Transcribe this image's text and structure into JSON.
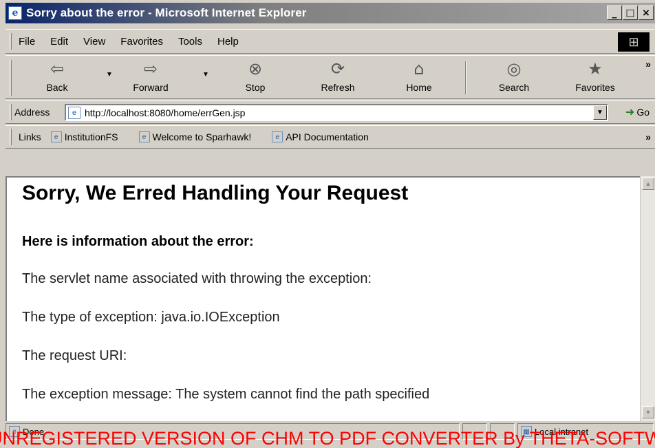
{
  "window": {
    "title": "Sorry about the error - Microsoft Internet Explorer",
    "controls": {
      "minimize": "_",
      "maximize": "□",
      "close": "×"
    }
  },
  "menu": {
    "items": [
      {
        "label": "File"
      },
      {
        "label": "Edit"
      },
      {
        "label": "View"
      },
      {
        "label": "Favorites"
      },
      {
        "label": "Tools"
      },
      {
        "label": "Help"
      }
    ]
  },
  "toolbar": {
    "buttons": [
      {
        "label": "Back",
        "icon": "back-arrow-icon",
        "glyph": "⇦"
      },
      {
        "label": "Forward",
        "icon": "forward-arrow-icon",
        "glyph": "⇨"
      },
      {
        "label": "Stop",
        "icon": "stop-icon",
        "glyph": "⊗"
      },
      {
        "label": "Refresh",
        "icon": "refresh-icon",
        "glyph": "⟳"
      },
      {
        "label": "Home",
        "icon": "home-icon",
        "glyph": "⌂"
      },
      {
        "label": "Search",
        "icon": "search-icon",
        "glyph": "◎"
      },
      {
        "label": "Favorites",
        "icon": "favorites-icon",
        "glyph": "★"
      }
    ],
    "more": "»"
  },
  "address": {
    "label": "Address",
    "url": "http://localhost:8080/home/errGen.jsp",
    "go_label": "Go"
  },
  "links": {
    "label": "Links",
    "items": [
      {
        "label": "InstitutionFS"
      },
      {
        "label": "Welcome to Sparhawk!"
      },
      {
        "label": "API Documentation"
      }
    ],
    "more": "»"
  },
  "page": {
    "heading": "Sorry, We Erred Handling Your Request",
    "subheading": "Here is information about the error:",
    "lines": [
      "The servlet name associated with throwing the exception:",
      "The type of exception: java.io.IOException",
      "The request URI:",
      "The exception message: The system cannot find the path specified"
    ]
  },
  "status": {
    "text": "Done",
    "zone": "Local intranet"
  },
  "watermark": {
    "text": "UNREGISTERED VERSION OF CHM TO PDF CONVERTER By THETA-SOFTWARE",
    "color": "#ff0000"
  }
}
